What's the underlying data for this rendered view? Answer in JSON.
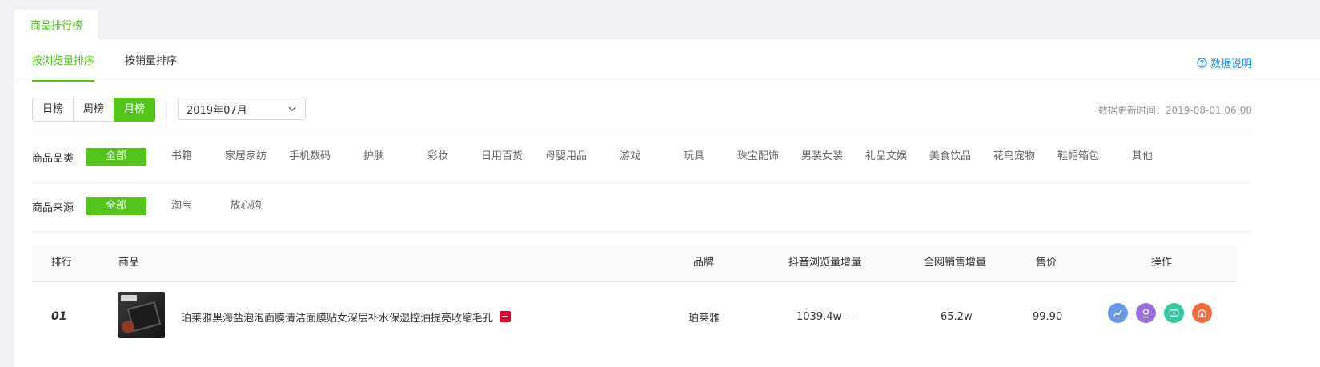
{
  "page_tab": "商品排行榜",
  "sub_tabs": [
    {
      "label": "按浏览量排序",
      "active": true
    },
    {
      "label": "按销量排序",
      "active": false
    }
  ],
  "help_link": "数据说明",
  "period_buttons": [
    {
      "label": "日榜",
      "active": false
    },
    {
      "label": "周榜",
      "active": false
    },
    {
      "label": "月榜",
      "active": true
    }
  ],
  "month_select": {
    "value": "2019年07月"
  },
  "update_info": {
    "label": "数据更新时间：",
    "value": "2019-08-01 06:00"
  },
  "category_filter": {
    "label": "商品品类",
    "options": [
      "全部",
      "书籍",
      "家居家纺",
      "手机数码",
      "护肤",
      "彩妆",
      "日用百货",
      "母婴用品",
      "游戏",
      "玩具",
      "珠宝配饰",
      "男装女装",
      "礼品文娱",
      "美食饮品",
      "花鸟宠物",
      "鞋帽箱包",
      "其他"
    ],
    "selected": "全部"
  },
  "source_filter": {
    "label": "商品来源",
    "options": [
      "全部",
      "淘宝",
      "放心购"
    ],
    "selected": "全部"
  },
  "table": {
    "headers": {
      "rank": "排行",
      "product": "商品",
      "brand": "品牌",
      "views": "抖音浏览量增量",
      "sales": "全网销售增量",
      "price": "售价",
      "actions": "操作"
    },
    "rows": [
      {
        "rank": "01",
        "product": "珀莱雅黑海盐泡泡面膜清洁面膜贴女深层补水保湿控油提亮收缩毛孔",
        "brand": "珀莱雅",
        "views": "1039.4w",
        "views_trend": "--",
        "sales": "65.2w",
        "price": "99.90"
      }
    ]
  },
  "action_icons": [
    {
      "name": "trend-chart-icon",
      "color": "#6a98e8"
    },
    {
      "name": "user-profile-icon",
      "color": "#9b6fe0"
    },
    {
      "name": "video-icon",
      "color": "#36c9a0"
    },
    {
      "name": "store-icon",
      "color": "#f56c3c"
    }
  ],
  "colors": {
    "accent": "#52c41a",
    "link": "#1890ff"
  }
}
